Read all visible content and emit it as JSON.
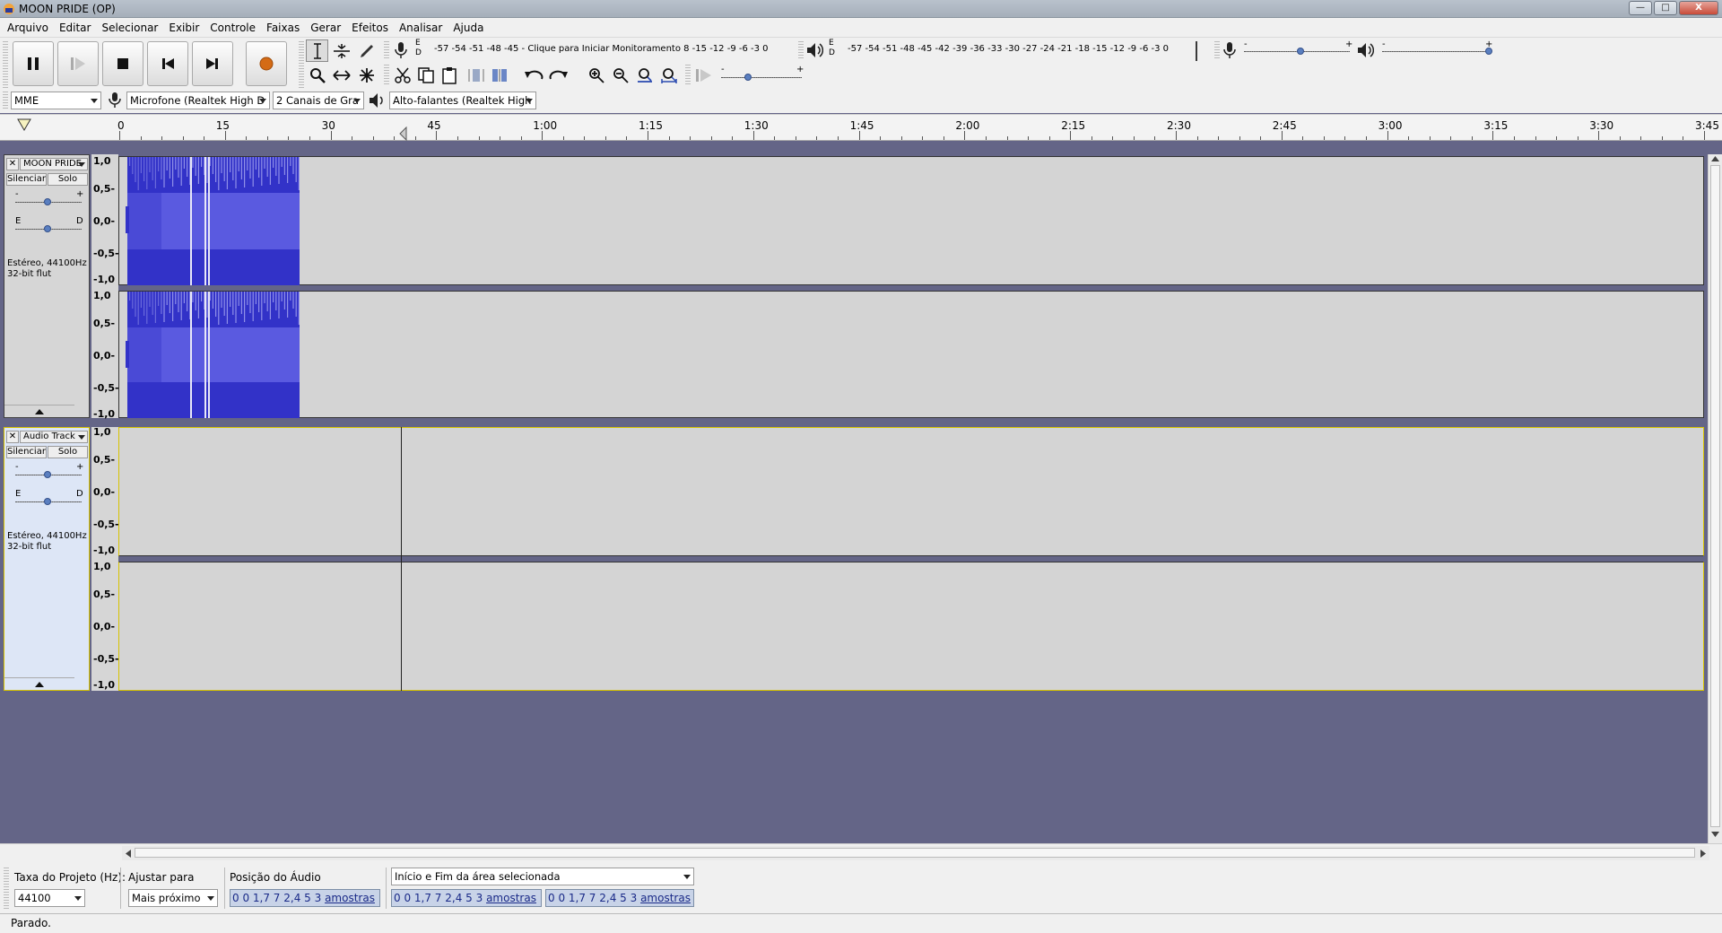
{
  "window": {
    "title": "MOON PRIDE (OP)",
    "controls": [
      "—",
      "□",
      "X"
    ]
  },
  "menu": [
    "Arquivo",
    "Editar",
    "Selecionar",
    "Exibir",
    "Controle",
    "Faixas",
    "Gerar",
    "Efeitos",
    "Analisar",
    "Ajuda"
  ],
  "transport": {
    "buttons": [
      "pause-icon",
      "play-icon",
      "stop-icon",
      "skip-start-icon",
      "skip-end-icon",
      "record-icon"
    ],
    "record_color": "#d46b15"
  },
  "meters": {
    "record_channels": [
      "E",
      "D"
    ],
    "record_scale": "-57 -54 -51 -48 -45 - Clique para Iniciar Monitoramento 8 -15 -12  -9  -6  -3  0",
    "play_channels": [
      "E",
      "D"
    ],
    "play_scale": "-57 -54 -51 -48 -45 -42 -39 -36 -33 -30 -27 -24 -21 -18 -15 -12  -9  -6  -3  0"
  },
  "mixer": {
    "minus": "-",
    "plus": "+"
  },
  "devices": {
    "host": "MME",
    "input": "Microfone (Realtek High D",
    "channels": "2 Canais de  Gra",
    "output": "Alto-falantes (Realtek High"
  },
  "timeline": {
    "labels": [
      "0",
      "15",
      "30",
      "45",
      "1:00",
      "1:15",
      "1:30",
      "1:45",
      "2:00",
      "2:15",
      "2:30",
      "2:45",
      "3:00",
      "3:15",
      "3:30",
      "3:45"
    ]
  },
  "tracks": [
    {
      "name": "MOON PRIDE",
      "mute": "Silenciar",
      "solo": "Solo",
      "gain_minus": "-",
      "gain_plus": "+",
      "pan_left": "E",
      "pan_right": "D",
      "info1": "Estéreo, 44100Hz",
      "info2": "32-bit flut",
      "scale": [
        "1,0",
        "0,5-",
        "0,0-",
        "-0,5-",
        "-1,0"
      ]
    },
    {
      "name": "Audio Track",
      "mute": "Silenciar",
      "solo": "Solo",
      "gain_minus": "-",
      "gain_plus": "+",
      "pan_left": "E",
      "pan_right": "D",
      "info1": "Estéreo, 44100Hz",
      "info2": "32-bit flut",
      "scale": [
        "1,0",
        "0,5-",
        "0,0-",
        "-0,5-",
        "-1,0"
      ]
    }
  ],
  "waveform_color": "#3232c8",
  "selection": {
    "rate_label": "Taxa do Projeto (Hz):",
    "rate_value": "44100",
    "snap_label": "Ajustar para",
    "snap_value": "Mais próximo",
    "position_label": "Posição do Áudio",
    "selection_mode": "Início e Fim da área selecionada",
    "position_time": "0 0 1,7 7 2,4 5 3",
    "start_time": "0 0 1,7 7 2,4 5 3",
    "end_time": "0 0 1,7 7 2,4 5 3",
    "units": "amostras"
  },
  "status": "Parado."
}
